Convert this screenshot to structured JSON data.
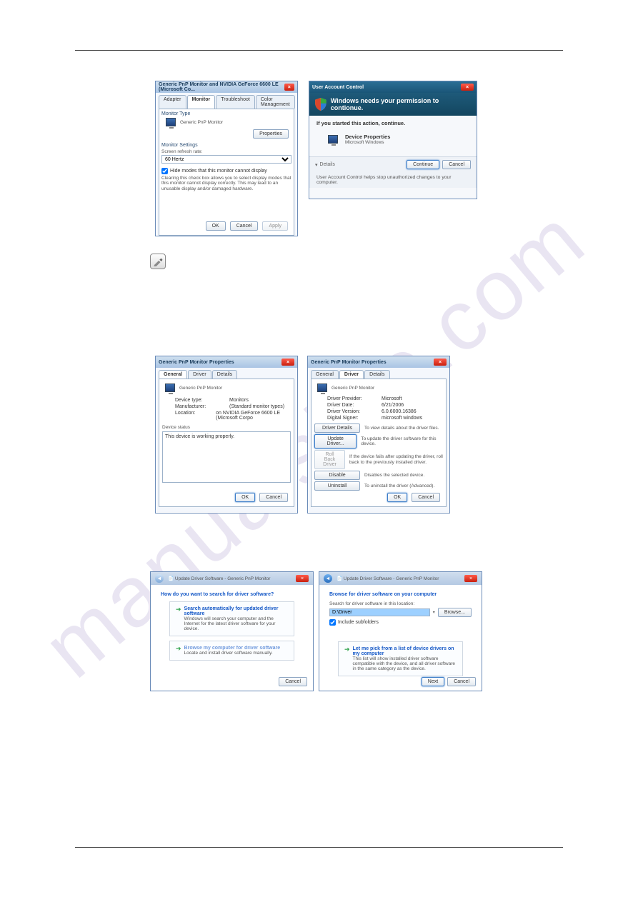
{
  "watermark": "manualshre.com",
  "dlg1": {
    "title": "Generic PnP Monitor and NVIDIA GeForce 6600 LE (Microsoft Co...",
    "tabs": {
      "adapter": "Adapter",
      "monitor": "Monitor",
      "troubleshoot": "Troubleshoot",
      "color": "Color Management"
    },
    "monitor_type_label": "Monitor Type",
    "monitor_name": "Generic PnP Monitor",
    "properties_btn": "Properties",
    "monitor_settings_label": "Monitor Settings",
    "refresh_label": "Screen refresh rate:",
    "refresh_value": "60 Hertz",
    "hide_modes": "Hide modes that this monitor cannot display",
    "hide_modes_help": "Clearing this check box allows you to select display modes that this monitor cannot display correctly. This may lead to an unusable display and/or damaged hardware.",
    "ok": "OK",
    "cancel": "Cancel",
    "apply": "Apply"
  },
  "uac": {
    "title": "User Account Control",
    "headline": "Windows needs your permission to contionue.",
    "started": "If you started this action, continue.",
    "item_title": "Device Properties",
    "item_sub": "Microsoft Windows",
    "details": "Details",
    "continue": "Continue",
    "cancel": "Cancel",
    "footer": "User Account Control helps stop unauthorized changes to your computer."
  },
  "props_general": {
    "title": "Generic PnP Monitor Properties",
    "tabs": {
      "general": "General",
      "driver": "Driver",
      "details": "Details"
    },
    "name": "Generic PnP Monitor",
    "devtype_k": "Device type:",
    "devtype_v": "Monitors",
    "mfr_k": "Manufacturer:",
    "mfr_v": "(Standard monitor types)",
    "loc_k": "Location:",
    "loc_v": "on NVIDIA GeForce 6600 LE (Microsoft Corpo",
    "status_label": "Device status",
    "status_text": "This device is working properly.",
    "ok": "OK",
    "cancel": "Cancel"
  },
  "props_driver": {
    "title": "Generic PnP Monitor Properties",
    "tabs": {
      "general": "General",
      "driver": "Driver",
      "details": "Details"
    },
    "name": "Generic PnP Monitor",
    "provider_k": "Driver Provider:",
    "provider_v": "Microsoft",
    "date_k": "Driver Date:",
    "date_v": "6/21/2006",
    "ver_k": "Driver Version:",
    "ver_v": "6.0.6000.16386",
    "signer_k": "Digital Signer:",
    "signer_v": "microsoft windows",
    "btn_details": "Driver Details",
    "btn_details_help": "To view details about the driver files.",
    "btn_update": "Update Driver...",
    "btn_update_help": "To update the driver software for this device.",
    "btn_rollback": "Roll Back Driver",
    "btn_rollback_help": "If the device fails after updating the driver, roll back to the previously installed driver.",
    "btn_disable": "Disable",
    "btn_disable_help": "Disables the selected device.",
    "btn_uninstall": "Uninstall",
    "btn_uninstall_help": "To uninstall the driver (Advanced).",
    "ok": "OK",
    "cancel": "Cancel"
  },
  "wiz1": {
    "title": "Update Driver Software - Generic PnP Monitor",
    "heading": "How do you want to search for driver software?",
    "opt1_title": "Search automatically for updated driver software",
    "opt1_sub": "Windows will search your computer and the Internet for the latest driver software for your device.",
    "opt2_title": "Browse my computer for driver software",
    "opt2_sub": "Locate and install driver software manually.",
    "cancel": "Cancel"
  },
  "wiz2": {
    "title": "Update Driver Software - Generic PnP Monitor",
    "heading": "Browse for driver software on your computer",
    "search_label": "Search for driver software in this location:",
    "path_value": "D:\\Driver",
    "browse": "Browse...",
    "include_sub": "Include subfolders",
    "opt_title": "Let me pick from a list of device drivers on my computer",
    "opt_sub": "This list will show installed driver software compatible with the device, and all driver software in the same category as the device.",
    "next": "Next",
    "cancel": "Cancel"
  }
}
